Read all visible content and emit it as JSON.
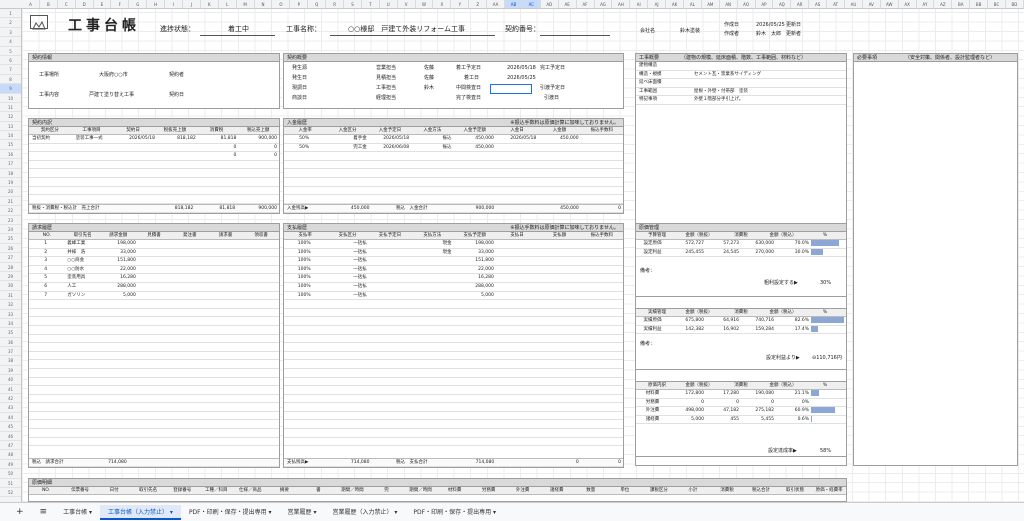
{
  "colLetters": [
    "A",
    "B",
    "C",
    "D",
    "E",
    "F",
    "G",
    "H",
    "I",
    "J",
    "K",
    "L",
    "M",
    "N",
    "O",
    "P",
    "Q",
    "R",
    "S",
    "T",
    "U",
    "V",
    "W",
    "X",
    "Y",
    "Z",
    "AA",
    "AB",
    "AC",
    "AD",
    "AE",
    "AF",
    "AG",
    "AH",
    "AI",
    "AJ",
    "AK",
    "AL",
    "AM",
    "AN",
    "AO",
    "AP",
    "AQ",
    "AR",
    "AS",
    "AT",
    "AU",
    "AV",
    "AW",
    "AX",
    "AY",
    "AZ",
    "BA",
    "BB",
    "BC",
    "BD"
  ],
  "header": {
    "title": "工事台帳",
    "status_label": "進捗状態：",
    "status": "着工中",
    "project_label": "工事名称：",
    "project": "○○様邸　戸建て外装リフォーム工事",
    "contract_no_label": "契約番号：",
    "company_label": "会社名",
    "company": "鈴木塗装",
    "created_label": "作成日",
    "created": "2026/05/25",
    "updated_label": "更新日",
    "author_label": "作成者",
    "author": "鈴木　太郎",
    "updater_label": "更新者"
  },
  "contract_info": {
    "title": "契約情報",
    "site_label": "工事場所",
    "site": "大阪府○○市",
    "client_label": "契約者",
    "content_label": "工事内容",
    "content": "戸建て塗り替え工事",
    "contract_date_label": "契約日"
  },
  "contract_summary": {
    "title": "契約概要",
    "labels": [
      "発生源",
      "発生日",
      "現調日",
      "商談日"
    ],
    "sales_label": "営業担当",
    "sales": "佐藤",
    "estimate_label": "見積担当",
    "estimate": "佐藤",
    "work_label": "工事担当",
    "work": "鈴木",
    "acct_label": "経理担当",
    "start_plan_label": "着工予定日",
    "start_plan": "2026/05/18",
    "end_plan_label": "完工予定日",
    "start_label": "着工日",
    "start": "2026/05/25",
    "mid_label": "中間検査日",
    "handover_plan_label": "引渡予定日",
    "end_label": "完了検査日",
    "handover_label": "引渡日"
  },
  "job_summary": {
    "title": "工事概要",
    "subtitle": "（建物の規模、延床面積、階数、工事範囲、材料など）",
    "rows": [
      [
        "建物構造",
        ""
      ],
      [
        "構造・規模",
        "セメント瓦・窯業系サイディング"
      ],
      [
        "延べ床面積",
        ""
      ],
      [
        "工事範囲",
        "屋根・外壁・付帯部　塗装"
      ],
      [
        "特記事項",
        "外壁１階部分手引上げ。"
      ]
    ]
  },
  "required": {
    "title": "必要事項",
    "subtitle": "（安全対策、関係者、設計監理者など）"
  },
  "contract_detail": {
    "title": "契約内訳",
    "cols": [
      "契約区分",
      "工事項目",
      "契約日",
      "税抜売上額",
      "消費税",
      "税込売上額"
    ],
    "rows": [
      [
        "当初契約",
        "塗装工事一式",
        "2026/05/18",
        "818,182",
        "81,818",
        "900,000"
      ],
      [
        "",
        "",
        "",
        "",
        "0",
        "0"
      ],
      [
        "",
        "",
        "",
        "",
        "0",
        "0"
      ]
    ],
    "total_label": "税抜・消費税・税込計　売上合計",
    "total": [
      "818,182",
      "81,818",
      "900,000"
    ]
  },
  "payments_in": {
    "title": "入金履歴",
    "note": "※振込手数料は原価計算に加味しておりません。",
    "cols": [
      "入金率",
      "入金区分",
      "入金予定日",
      "入金方法",
      "入金予定額",
      "入金日",
      "入金額",
      "振込手数料"
    ],
    "rows": [
      [
        "50%",
        "着手金",
        "2026/05/18",
        "振込",
        "450,000",
        "2026/05/18",
        "450,000",
        ""
      ],
      [
        "50%",
        "完工金",
        "2026/06/08",
        "振込",
        "450,000",
        "",
        "",
        ""
      ]
    ],
    "remain_label": "入金残高▶",
    "remain": "450,000",
    "total_label": "税込　入金合計",
    "total_plan": "900,000",
    "total_in": "450,000",
    "fee": "0"
  },
  "billing": {
    "title": "請求履歴",
    "cols": [
      "NO.",
      "取引先名",
      "請求金額",
      "見積書",
      "発注書",
      "請求書",
      "領収書"
    ],
    "rows": [
      [
        "1",
        "義峰工業",
        "198,000"
      ],
      [
        "2",
        "井様　浩",
        "33,000"
      ],
      [
        "3",
        "○○商会",
        "151,800"
      ],
      [
        "4",
        "○○防水",
        "22,000"
      ],
      [
        "5",
        "塗装用具",
        "16,280"
      ],
      [
        "6",
        "人工",
        "288,000"
      ],
      [
        "7",
        "ガソリン",
        "5,000"
      ]
    ],
    "total_label": "税込　請求合計",
    "total": "714,080"
  },
  "payments_out": {
    "title": "支払履歴",
    "note": "※振込手数料は原価計算に加味しておりません。",
    "cols": [
      "支払率",
      "支払区分",
      "支払予定日",
      "支払方法",
      "支払予定額",
      "支払日",
      "支払額",
      "振込手数料"
    ],
    "rows": [
      [
        "100%",
        "一括払",
        "",
        "現金",
        "198,000"
      ],
      [
        "100%",
        "一括払",
        "",
        "現金",
        "33,000"
      ],
      [
        "100%",
        "一括払",
        "",
        "",
        "151,800"
      ],
      [
        "100%",
        "一括払",
        "",
        "",
        "22,000"
      ],
      [
        "100%",
        "一括払",
        "",
        "",
        "16,280"
      ],
      [
        "100%",
        "一括払",
        "",
        "",
        "288,000"
      ],
      [
        "100%",
        "一括払",
        "",
        "",
        "5,000"
      ]
    ],
    "remain_label": "支払残高▶",
    "remain": "714,080",
    "total_label": "税込　支払合計",
    "total": "714,080",
    "paid": "0",
    "fee": "0"
  },
  "budget": {
    "title": "原価管理",
    "cols": [
      "予算管理",
      "金額（税抜）",
      "消費税",
      "金額（税込）",
      "%"
    ],
    "rows": [
      [
        "設定原価",
        "572,727",
        "57,273",
        "630,000",
        "70.0%",
        0.7
      ],
      [
        "設定利益",
        "245,455",
        "24,545",
        "270,000",
        "30.0%",
        0.3
      ]
    ],
    "note_label": "備考：",
    "profit_label": "粗利設定する▶",
    "profit_pct": "30%"
  },
  "actual": {
    "cols": [
      "実績管理",
      "金額（税抜）",
      "消費税",
      "金額（税込）",
      "%"
    ],
    "rows": [
      [
        "実績原価",
        "675,800",
        "64,916",
        "740,716",
        "82.6%",
        0.826
      ],
      [
        "実績利益",
        "142,382",
        "16,902",
        "159,284",
        "17.4%",
        0.174
      ]
    ],
    "note_label": "備考：",
    "diff_label": "設定利益より▶",
    "diff": "⊖110,716円"
  },
  "breakdown": {
    "cols": [
      "原価内訳",
      "金額（税抜）",
      "消費税",
      "金額（税込）",
      "%"
    ],
    "rows": [
      [
        "材料費",
        "172,800",
        "17,280",
        "190,080",
        "21.1%",
        0.211
      ],
      [
        "労務費",
        "0",
        "0",
        "0",
        "0%",
        0
      ],
      [
        "外注費",
        "498,000",
        "47,182",
        "275,182",
        "60.9%",
        0.609
      ],
      [
        "諸経費",
        "5,000",
        "455",
        "5,455",
        "0.6%",
        0.006
      ]
    ],
    "achieve_label": "設定達成率▶",
    "achieve": "58%"
  },
  "cost_detail": {
    "title": "原価明細",
    "cols": [
      "NO.",
      "伝票番号",
      "日付",
      "取引先名",
      "登録番号",
      "工種／科目",
      "仕様／商品",
      "摘要",
      "書",
      "期間／時間",
      "完",
      "期間／時間",
      "材料費",
      "労務費",
      "外注費",
      "諸経費",
      "数量",
      "単位",
      "課税区分",
      "小計",
      "消費税",
      "税込合計",
      "取引状態",
      "原価・経費率"
    ]
  },
  "tabs": [
    "工事台帳",
    "工事台帳（入力禁止）",
    "PDF・印刷・保存・提出専用",
    "営業履歴",
    "営業履歴（入力禁止）",
    "PDF・印刷・保存・提出専用"
  ]
}
